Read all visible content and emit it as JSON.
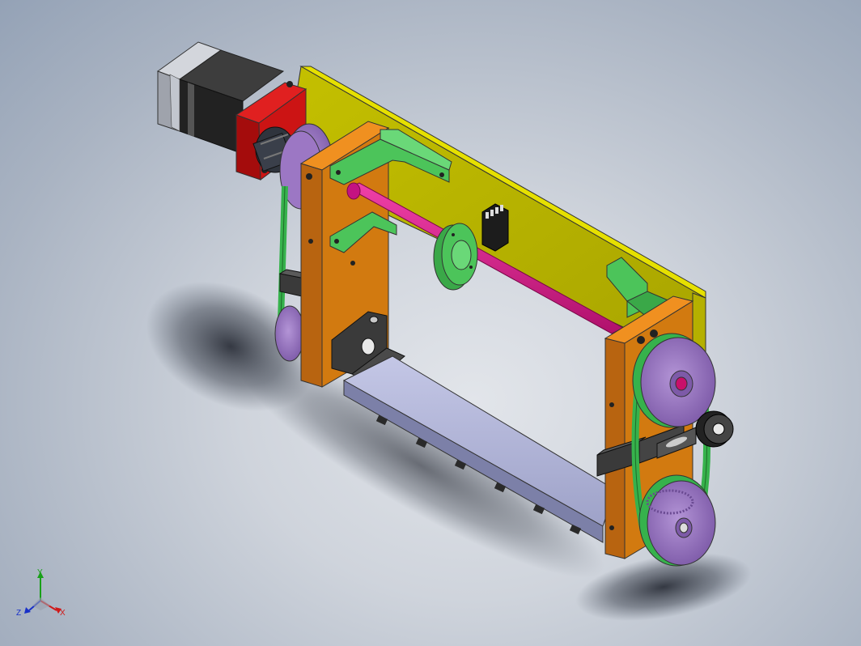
{
  "viewport": {
    "background_top": "#94a2b6",
    "background_center": "#e2e5ea"
  },
  "model": {
    "parts": [
      {
        "name": "stepper-motor",
        "color": "#2a2a2a",
        "accent": "#b9bcc4"
      },
      {
        "name": "motor-mount-flange",
        "color": "#cc1414"
      },
      {
        "name": "shaft-coupling",
        "color": "#3a3f4a"
      },
      {
        "name": "back-plate",
        "color": "#d7d000"
      },
      {
        "name": "side-plate-left",
        "color": "#d27a10"
      },
      {
        "name": "side-plate-right",
        "color": "#d27a10"
      },
      {
        "name": "brackets",
        "color": "#4cc45a"
      },
      {
        "name": "shaft",
        "color": "#e0138a"
      },
      {
        "name": "shaft-collar",
        "color": "#4cc45a"
      },
      {
        "name": "timing-pulleys",
        "color": "#9c77c4"
      },
      {
        "name": "timing-belts",
        "color": "#36b24c"
      },
      {
        "name": "linear-rail",
        "color": "#b7bbe0"
      },
      {
        "name": "bearing-blocks",
        "color": "#3a3a3a"
      },
      {
        "name": "sensor-module",
        "color": "#1c1c1c"
      },
      {
        "name": "idler-roller",
        "color": "#222222"
      }
    ]
  },
  "triad": {
    "x_label": "X",
    "y_label": "Y",
    "z_label": "Z",
    "x_color": "#d01818",
    "y_color": "#18a018",
    "z_color": "#1830c8"
  }
}
